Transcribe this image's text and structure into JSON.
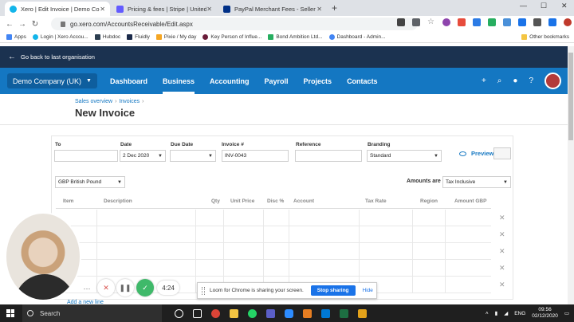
{
  "browser": {
    "tabs": [
      {
        "title": "Xero | Edit Invoice | Demo Co",
        "color": "#13b5ea",
        "active": true
      },
      {
        "title": "Pricing & fees | Stripe | United K",
        "color": "#635bff",
        "active": false
      },
      {
        "title": "PayPal Merchant Fees - Seller Fe",
        "color": "#003087",
        "active": false
      }
    ],
    "url": "go.xero.com/AccountsReceivable/Edit.aspx",
    "bookmarks": [
      "Apps",
      "Login | Xero Accou...",
      "Hubdoc",
      "Fluidly",
      "Pixie / My day",
      "Key Person of Influe...",
      "Bond Ambition Ltd...",
      "Dashboard - Admin..."
    ],
    "other_bookmarks": "Other bookmarks"
  },
  "xero": {
    "back_link": "Go back to last organisation",
    "org_name": "Demo Company (UK)",
    "menu": [
      "Dashboard",
      "Business",
      "Accounting",
      "Payroll",
      "Projects",
      "Contacts"
    ],
    "active_menu": "Business"
  },
  "page": {
    "breadcrumb": [
      "Sales overview",
      "Invoices"
    ],
    "title": "New Invoice"
  },
  "form": {
    "to_label": "To",
    "to_value": "",
    "date_label": "Date",
    "date_value": "2 Dec 2020",
    "due_label": "Due Date",
    "due_value": "",
    "invoice_label": "Invoice #",
    "invoice_value": "INV-0043",
    "reference_label": "Reference",
    "reference_value": "",
    "branding_label": "Branding",
    "branding_value": "Standard",
    "preview": "Preview",
    "currency": "GBP British Pound",
    "amounts_label": "Amounts are",
    "amounts_value": "Tax Inclusive"
  },
  "table": {
    "columns": [
      "Item",
      "Description",
      "Qty",
      "Unit Price",
      "Disc %",
      "Account",
      "Tax Rate",
      "Region",
      "Amount GBP"
    ],
    "row_count": 5,
    "add_line": "Add a new line"
  },
  "recording": {
    "timer": "4:24",
    "share_text": "Loom for Chrome is sharing your screen.",
    "stop_label": "Stop sharing",
    "hide_label": "Hide"
  },
  "taskbar": {
    "search_placeholder": "Search",
    "lang": "ENG",
    "time": "09:56",
    "date": "02/12/2020"
  }
}
